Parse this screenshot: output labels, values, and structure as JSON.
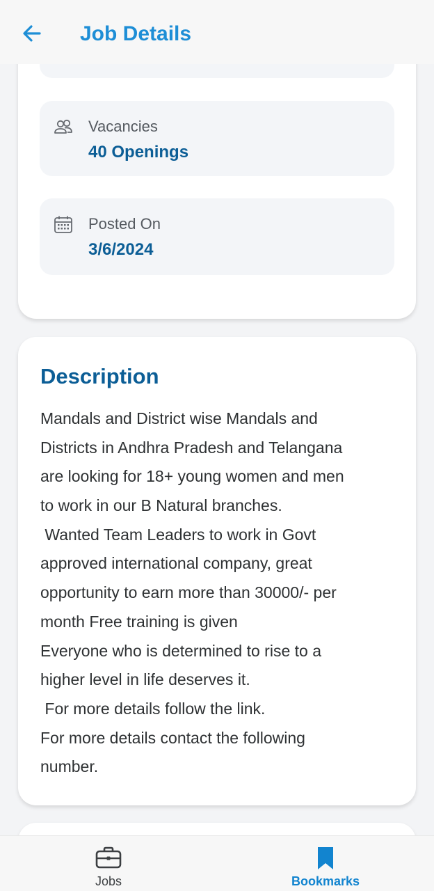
{
  "header": {
    "title": "Job Details",
    "back_icon": "arrow-left-icon"
  },
  "info": {
    "vacancies": {
      "label": "Vacancies",
      "value": "40 Openings",
      "icon": "people-icon"
    },
    "posted_on": {
      "label": "Posted On",
      "value": "3/6/2024",
      "icon": "calendar-icon"
    }
  },
  "description": {
    "title": "Description",
    "lines": [
      "Mandals and District wise Mandals and",
      "Districts in Andhra Pradesh and Telangana",
      "are looking for 18+ young women and men",
      "to work in our B Natural branches.",
      " Wanted Team Leaders to work in Govt",
      "approved international company, great",
      "opportunity to earn more than 30000/- per",
      "month Free training is given",
      "Everyone who is determined to rise to a",
      "higher level in life deserves it.",
      " For more details follow the link.",
      "For more details contact the following",
      "number."
    ]
  },
  "bottom_nav": {
    "jobs": {
      "label": "Jobs",
      "icon": "briefcase-icon"
    },
    "bookmarks": {
      "label": "Bookmarks",
      "icon": "bookmark-icon",
      "active": true
    }
  },
  "colors": {
    "accent": "#1e8ed6",
    "value_text": "#0c5e96",
    "background": "#f3f4f6"
  }
}
